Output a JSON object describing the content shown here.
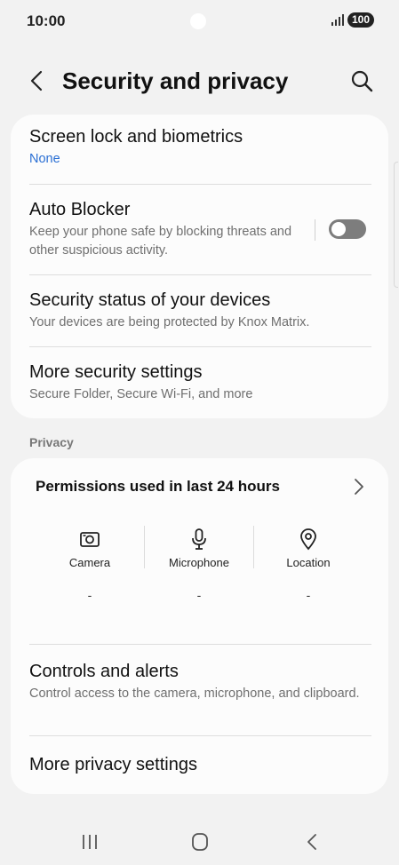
{
  "status_bar": {
    "time": "10:00",
    "battery": "100"
  },
  "header": {
    "title": "Security and privacy"
  },
  "security_items": [
    {
      "title": "Screen lock and biometrics",
      "subtitle": "None"
    },
    {
      "title": "Auto Blocker",
      "subtitle": "Keep your phone safe by blocking threats and other suspicious activity.",
      "toggle_on": false
    },
    {
      "title": "Security status of your devices",
      "subtitle": "Your devices are being protected by Knox Matrix."
    },
    {
      "title": "More security settings",
      "subtitle": "Secure Folder, Secure Wi-Fi, and more"
    }
  ],
  "privacy": {
    "section_label": "Privacy",
    "permissions_header": "Permissions used in last 24 hours",
    "permissions": [
      {
        "label": "Camera",
        "value": "-",
        "icon": "camera-icon"
      },
      {
        "label": "Microphone",
        "value": "-",
        "icon": "microphone-icon"
      },
      {
        "label": "Location",
        "value": "-",
        "icon": "location-icon"
      }
    ],
    "items": [
      {
        "title": "Controls and alerts",
        "subtitle": "Control access to the camera, microphone, and clipboard."
      },
      {
        "title": "More privacy settings"
      }
    ]
  },
  "colors": {
    "accent": "#2a6fd4",
    "background": "#f2f2f2",
    "card": "#fcfcfc"
  }
}
